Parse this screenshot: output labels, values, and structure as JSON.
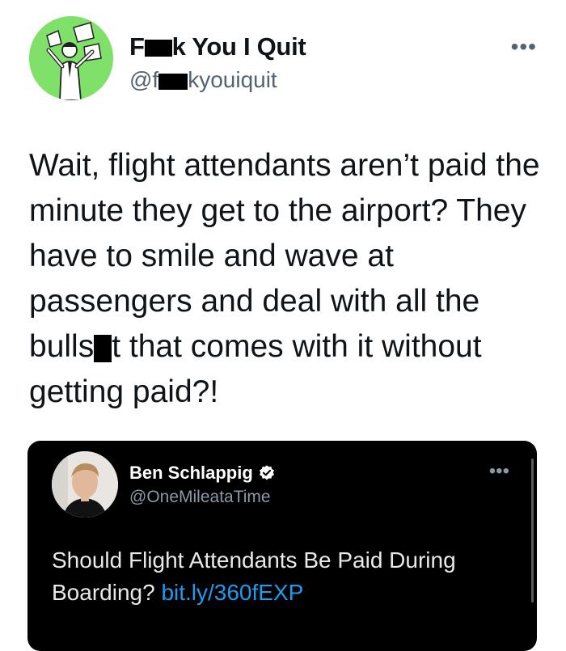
{
  "tweet": {
    "name_prefix": "F",
    "name_suffix": "k You I Quit",
    "handle_prefix": "@f",
    "handle_suffix": "kyouiquit",
    "more_icon": "•••",
    "text_before_redaction": "Wait, flight attendants aren’t paid the minute they get to the airport? They have to smile and wave at passengers and deal with all the bulls",
    "text_after_redaction": "t that comes with it without getting paid?!"
  },
  "quoted_tweet": {
    "name": "Ben Schlappig",
    "handle": "@OneMileataTime",
    "more_icon": "•••",
    "text": "Should Flight Attendants Be Paid During Boarding? ",
    "link": "bit.ly/360fEXP"
  },
  "colors": {
    "avatar_bg": "#7fe06a",
    "link": "#1d9bf0",
    "verified": "#ffffff"
  }
}
